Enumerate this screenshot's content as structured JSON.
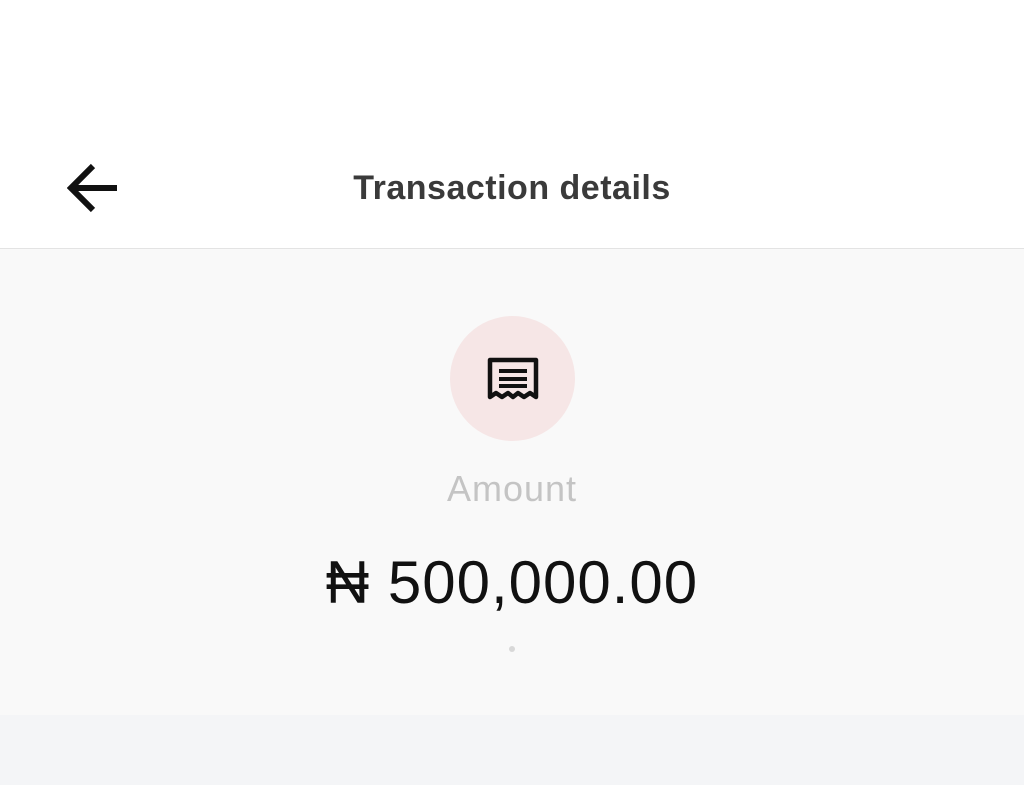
{
  "header": {
    "title": "Transaction details",
    "back_icon": "arrow-left-icon"
  },
  "summary": {
    "icon": "receipt-icon",
    "label": "Amount",
    "amount": "₦ 500,000.00"
  },
  "colors": {
    "badge_background": "#f6e6e6",
    "content_background": "#f9f9f9",
    "title_text": "#3a3a3a",
    "label_text": "#c4c4c4",
    "amount_text": "#111111"
  }
}
